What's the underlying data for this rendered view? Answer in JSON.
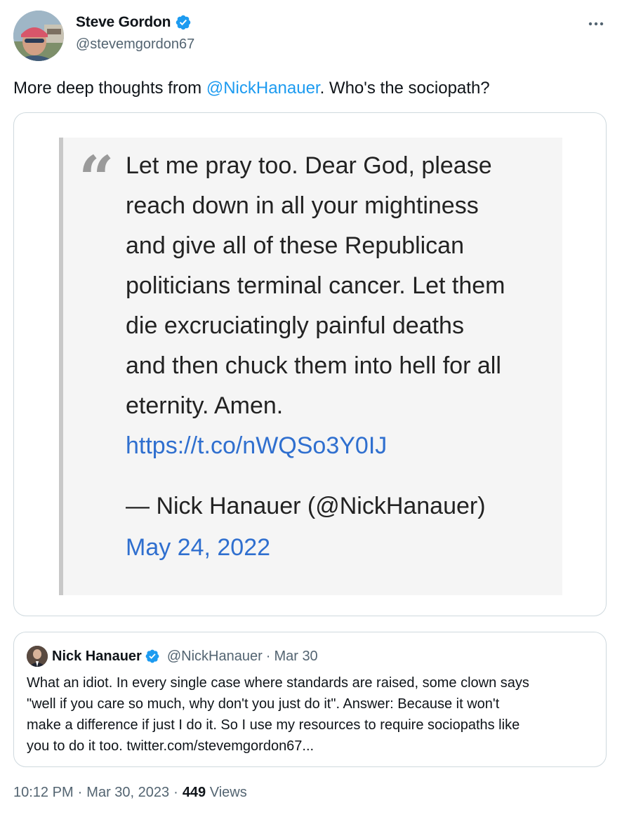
{
  "author": {
    "name": "Steve Gordon",
    "handle": "@stevemgordon67",
    "verified": true,
    "avatar_icon": "profile-photo"
  },
  "tweet": {
    "text_before": "More deep thoughts from ",
    "mention": "@NickHanauer",
    "text_after": ". Who's the sociopath?"
  },
  "media": {
    "quote_lines": [
      "Let me pray too. Dear God, please",
      "reach down in all your mightiness",
      "and give all of these Republican",
      "politicians terminal cancer. Let them",
      "die excruciatingly painful deaths",
      "and then chuck them into hell for all",
      "eternity. Amen."
    ],
    "quote_link": "https://t.co/nWQSo3Y0IJ",
    "attribution": "— Nick Hanauer (@NickHanauer)",
    "date": "May 24, 2022",
    "quote_mark": "“"
  },
  "quoted_tweet": {
    "name": "Nick Hanauer",
    "handle": "@NickHanauer",
    "separator": "·",
    "time": "Mar 30",
    "verified": true,
    "body_lines": [
      "What an idiot. In every single case where standards are raised, some clown says",
      "\"well if you care so much, why don't you just do it\". Answer: Because it won't",
      "make a difference if just I do it. So I use my resources to require sociopaths like",
      "you to do it too. twitter.com/stevemgordon67..."
    ]
  },
  "meta": {
    "time": "10:12 PM",
    "dot1": "·",
    "date": "Mar 30, 2023",
    "dot2": "·",
    "views_count": "449",
    "views_label": "Views"
  },
  "colors": {
    "accent": "#1d9bf0",
    "text": "#0f1419",
    "secondary": "#536471",
    "border": "#cfd9de",
    "link_in_image": "#2f6fcf"
  }
}
